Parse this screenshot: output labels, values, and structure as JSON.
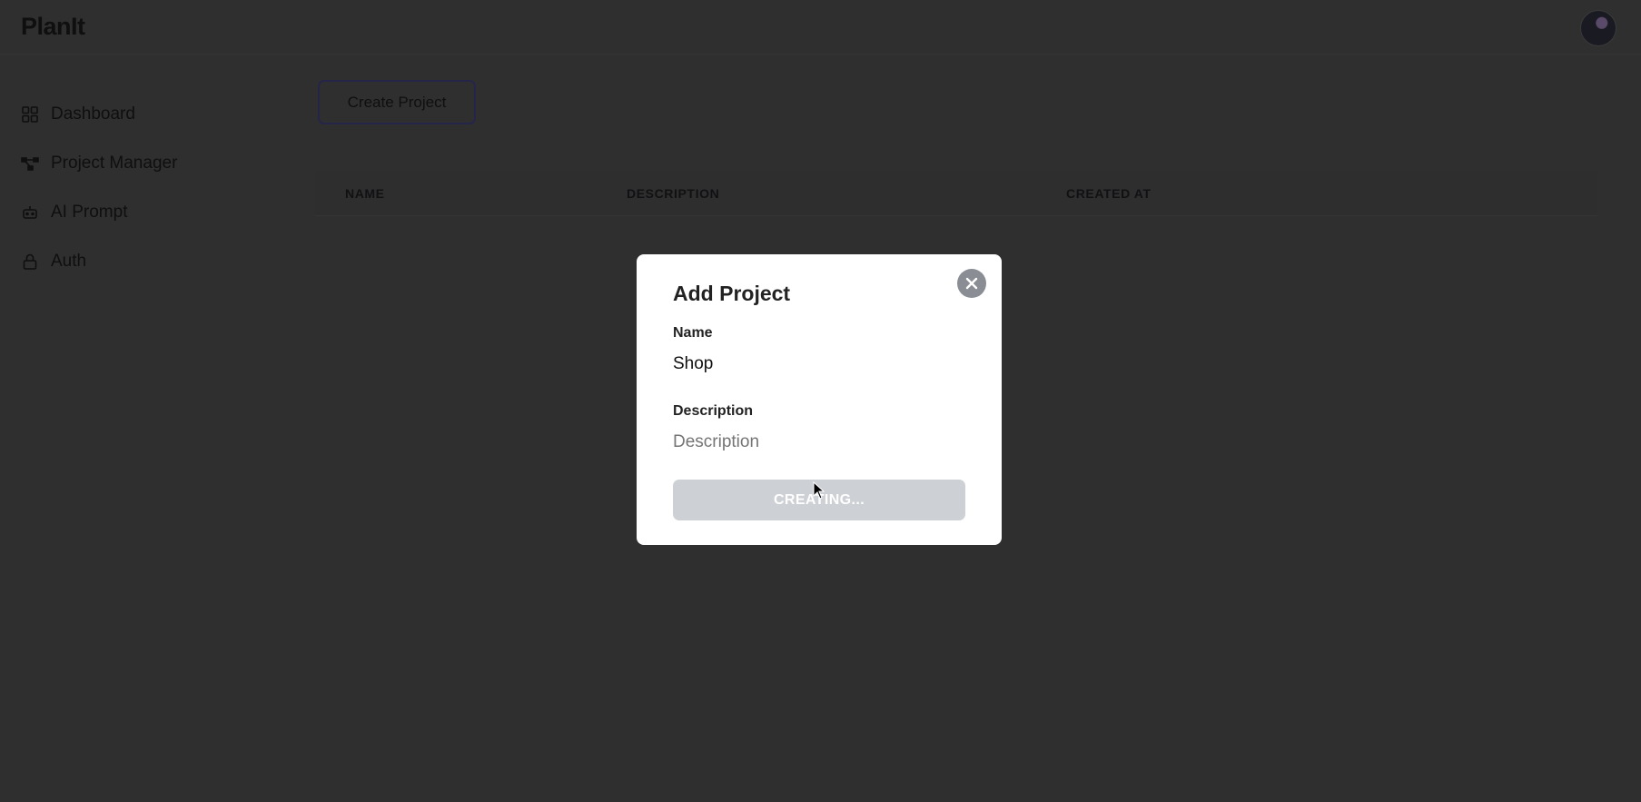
{
  "app": {
    "title": "PlanIt"
  },
  "sidebar": {
    "items": [
      {
        "label": "Dashboard",
        "icon": "grid-icon"
      },
      {
        "label": "Project Manager",
        "icon": "nodes-icon"
      },
      {
        "label": "AI Prompt",
        "icon": "robot-icon"
      },
      {
        "label": "Auth",
        "icon": "lock-icon"
      }
    ]
  },
  "main": {
    "create_button": "Create Project",
    "table": {
      "columns": [
        "NAME",
        "DESCRIPTION",
        "CREATED AT"
      ],
      "rows": []
    }
  },
  "modal": {
    "title": "Add Project",
    "name_label": "Name",
    "name_value": "Shop",
    "description_label": "Description",
    "description_placeholder": "Description",
    "submit_label": "CREATING..."
  },
  "colors": {
    "overlay": "#2f2f2f",
    "modal_bg": "#ffffff",
    "submit_disabled": "#cdd0d5",
    "close_button": "#8a8e94"
  }
}
